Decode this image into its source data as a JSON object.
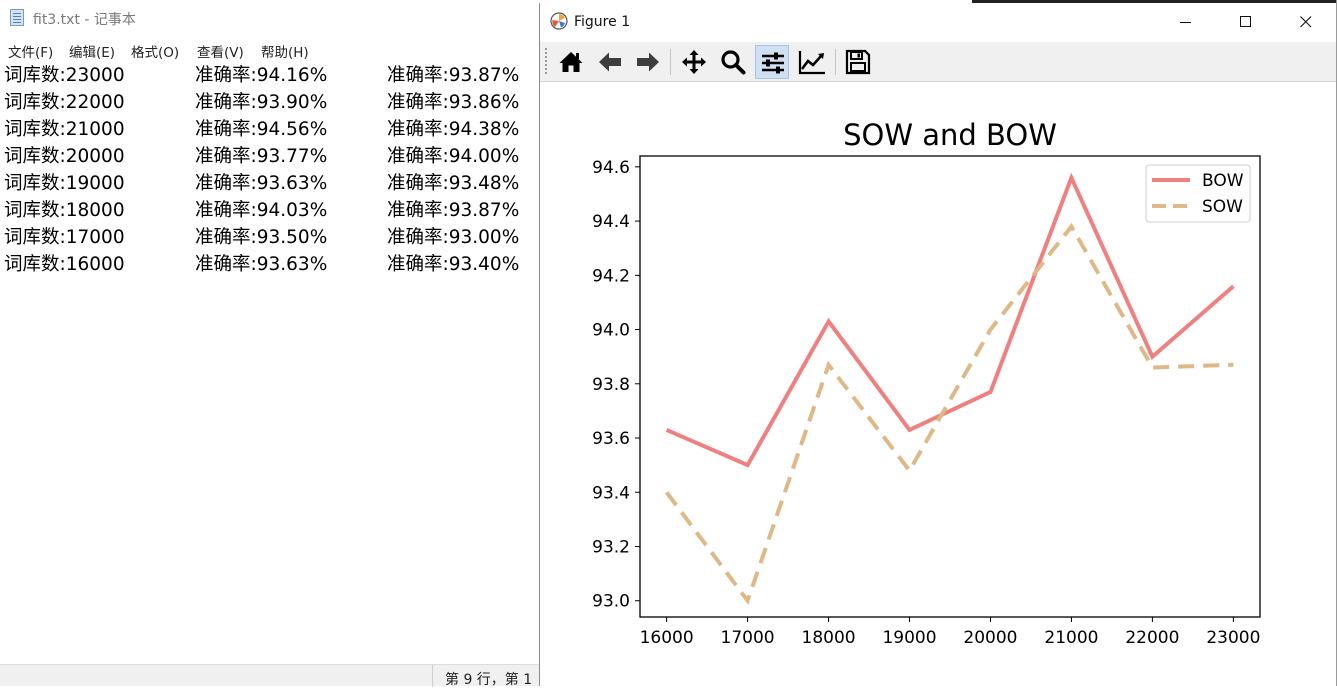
{
  "notepad": {
    "title": "fit3.txt - 记事本",
    "menu": [
      "文件(F)",
      "编辑(E)",
      "格式(O)",
      "查看(V)",
      "帮助(H)"
    ],
    "lines": [
      [
        "词库数:23000",
        "准确率:94.16%",
        "准确率:93.87%"
      ],
      [
        "词库数:22000",
        "准确率:93.90%",
        "准确率:93.86%"
      ],
      [
        "词库数:21000",
        "准确率:94.56%",
        "准确率:94.38%"
      ],
      [
        "词库数:20000",
        "准确率:93.77%",
        "准确率:94.00%"
      ],
      [
        "词库数:19000",
        "准确率:93.63%",
        "准确率:93.48%"
      ],
      [
        "词库数:18000",
        "准确率:94.03%",
        "准确率:93.87%"
      ],
      [
        "词库数:17000",
        "准确率:93.50%",
        "准确率:93.00%"
      ],
      [
        "词库数:16000",
        "准确率:93.63%",
        "准确率:93.40%"
      ]
    ],
    "status": "第 9 行，第 1"
  },
  "figure": {
    "window_title": "Figure 1",
    "toolbar": [
      {
        "icon": "home-icon",
        "label": "Home"
      },
      {
        "icon": "back-arrow-icon",
        "label": "Back"
      },
      {
        "icon": "forward-arrow-icon",
        "label": "Forward"
      },
      {
        "icon": "pan-move-icon",
        "label": "Pan"
      },
      {
        "icon": "zoom-magnifier-icon",
        "label": "Zoom"
      },
      {
        "icon": "configure-subplots-icon",
        "label": "Subplots",
        "active": true
      },
      {
        "icon": "edit-axis-icon",
        "label": "Customize"
      },
      {
        "icon": "save-floppy-icon",
        "label": "Save"
      }
    ]
  },
  "chart_data": {
    "type": "line",
    "title": "SOW and BOW",
    "xlabel": "",
    "ylabel": "",
    "x": [
      16000,
      17000,
      18000,
      19000,
      20000,
      21000,
      22000,
      23000
    ],
    "xticks": [
      "16000",
      "17000",
      "18000",
      "19000",
      "20000",
      "21000",
      "22000",
      "23000"
    ],
    "yticks": [
      "93.0",
      "93.2",
      "93.4",
      "93.6",
      "93.8",
      "94.0",
      "94.2",
      "94.4",
      "94.6"
    ],
    "ylim": [
      92.94,
      94.64
    ],
    "series": [
      {
        "name": "BOW",
        "values": [
          93.63,
          93.5,
          94.03,
          93.63,
          93.77,
          94.56,
          93.9,
          94.16
        ],
        "color": "#f08080",
        "dash": "solid"
      },
      {
        "name": "SOW",
        "values": [
          93.4,
          93.0,
          93.87,
          93.48,
          94.0,
          94.38,
          93.86,
          93.87
        ],
        "color": "#deb887",
        "dash": "dashed"
      }
    ],
    "legend": "top-right",
    "grid": false
  }
}
